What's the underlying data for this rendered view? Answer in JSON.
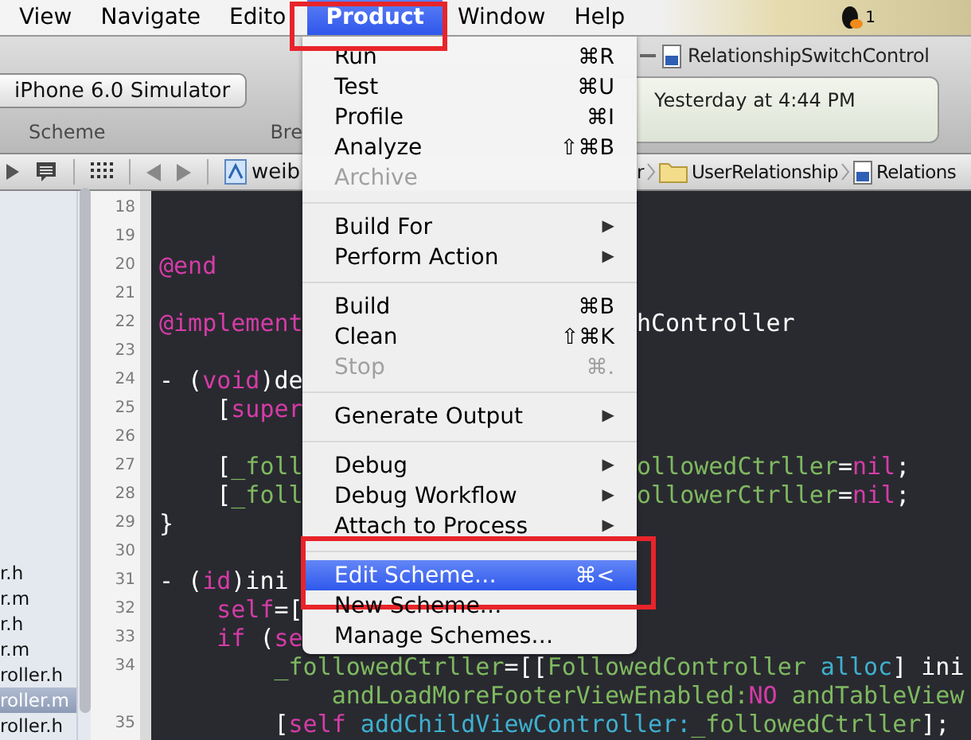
{
  "menubar": {
    "items": [
      {
        "label": "View",
        "selected": false,
        "outlined": false
      },
      {
        "label": "Navigate",
        "selected": false,
        "outlined": false
      },
      {
        "label": "Edito",
        "selected": false,
        "outlined": false
      },
      {
        "label": "Product",
        "selected": true,
        "outlined": true
      },
      {
        "label": "Window",
        "selected": false,
        "outlined": false
      },
      {
        "label": "Help",
        "selected": false,
        "outlined": false
      }
    ],
    "badge": "1"
  },
  "toolbar": {
    "scheme": "iPhone 6.0 Simulator",
    "labels": [
      "Scheme",
      "Bre"
    ],
    "document_title": "RelationshipSwitchControl",
    "activity": "Yesterday at 4:44 PM"
  },
  "jump_bar": {
    "left_text": "weib",
    "right_items": [
      {
        "kind": "text",
        "label": "r"
      },
      {
        "kind": "folder",
        "label": "UserRelationship"
      },
      {
        "kind": "source",
        "label": "Relations"
      }
    ]
  },
  "navigator": {
    "files": [
      {
        "name": "r.h",
        "selected": false
      },
      {
        "name": "r.m",
        "selected": false
      },
      {
        "name": "r.h",
        "selected": false
      },
      {
        "name": "r.m",
        "selected": false
      },
      {
        "name": "roller.h",
        "selected": false
      },
      {
        "name": "roller.m",
        "selected": true
      },
      {
        "name": "roller.h",
        "selected": false
      }
    ]
  },
  "menu": {
    "items": [
      {
        "kind": "item",
        "label": "Run",
        "shortcut": "⌘R",
        "disabled": false,
        "selected": false,
        "outlined": false
      },
      {
        "kind": "item",
        "label": "Test",
        "shortcut": "⌘U",
        "disabled": false,
        "selected": false,
        "outlined": false
      },
      {
        "kind": "item",
        "label": "Profile",
        "shortcut": "⌘I",
        "disabled": false,
        "selected": false,
        "outlined": false
      },
      {
        "kind": "item",
        "label": "Analyze",
        "shortcut": "⇧⌘B",
        "disabled": false,
        "selected": false,
        "outlined": false
      },
      {
        "kind": "item",
        "label": "Archive",
        "disabled": true,
        "selected": false,
        "outlined": false
      },
      {
        "kind": "separator"
      },
      {
        "kind": "submenu",
        "label": "Build For",
        "arrow": "▶",
        "disabled": false,
        "selected": false,
        "outlined": false
      },
      {
        "kind": "submenu",
        "label": "Perform Action",
        "arrow": "▶",
        "disabled": false,
        "selected": false,
        "outlined": false
      },
      {
        "kind": "separator"
      },
      {
        "kind": "item",
        "label": "Build",
        "shortcut": "⌘B",
        "disabled": false,
        "selected": false,
        "outlined": false
      },
      {
        "kind": "item",
        "label": "Clean",
        "shortcut": "⇧⌘K",
        "disabled": false,
        "selected": false,
        "outlined": false
      },
      {
        "kind": "item",
        "label": "Stop",
        "shortcut": "⌘.",
        "disabled": true,
        "selected": false,
        "outlined": false
      },
      {
        "kind": "separator"
      },
      {
        "kind": "submenu",
        "label": "Generate Output",
        "arrow": "▶",
        "disabled": false,
        "selected": false,
        "outlined": false
      },
      {
        "kind": "separator"
      },
      {
        "kind": "submenu",
        "label": "Debug",
        "arrow": "▶",
        "disabled": false,
        "selected": false,
        "outlined": false
      },
      {
        "kind": "submenu",
        "label": "Debug Workflow",
        "arrow": "▶",
        "disabled": false,
        "selected": false,
        "outlined": false
      },
      {
        "kind": "submenu",
        "label": "Attach to Process",
        "arrow": "▶",
        "disabled": false,
        "selected": false,
        "outlined": false
      },
      {
        "kind": "separator"
      },
      {
        "kind": "item",
        "label": "Edit Scheme…",
        "shortcut": "⌘<",
        "disabled": false,
        "selected": true,
        "outlined": true
      },
      {
        "kind": "item",
        "label": "New Scheme…",
        "disabled": false,
        "selected": false,
        "outlined": false
      },
      {
        "kind": "item",
        "label": "Manage Schemes…",
        "disabled": false,
        "selected": false,
        "outlined": false
      }
    ]
  },
  "editor": {
    "lines": [
      {
        "number": "18"
      },
      {
        "number": "19"
      },
      {
        "number": "20",
        "left": [
          {
            "text": "@end",
            "kind": "keyword"
          }
        ]
      },
      {
        "number": "21"
      },
      {
        "number": "22",
        "left": [
          {
            "text": "@implement",
            "kind": "keyword"
          }
        ],
        "right": [
          {
            "text": "hController",
            "kind": "plain"
          }
        ]
      },
      {
        "number": "23"
      },
      {
        "number": "24",
        "left": [
          {
            "text": "- (",
            "kind": "plain"
          },
          {
            "text": "void",
            "kind": "keyword"
          },
          {
            "text": ")de",
            "kind": "plain"
          }
        ]
      },
      {
        "number": "25",
        "left": [
          {
            "text": "    [",
            "kind": "plain"
          },
          {
            "text": "super",
            "kind": "keyword"
          }
        ]
      },
      {
        "number": "26"
      },
      {
        "number": "27",
        "left": [
          {
            "text": "    [",
            "kind": "plain"
          },
          {
            "text": "_foll",
            "kind": "project"
          }
        ],
        "right": [
          {
            "text": "ollowedCtrller",
            "kind": "project"
          },
          {
            "text": "=",
            "kind": "plain"
          },
          {
            "text": "nil",
            "kind": "keyword"
          },
          {
            "text": ";",
            "kind": "plain"
          }
        ]
      },
      {
        "number": "28",
        "left": [
          {
            "text": "    [",
            "kind": "plain"
          },
          {
            "text": "_foll",
            "kind": "project"
          }
        ],
        "right": [
          {
            "text": "ollowerCtrller",
            "kind": "project"
          },
          {
            "text": "=",
            "kind": "plain"
          },
          {
            "text": "nil",
            "kind": "keyword"
          },
          {
            "text": ";",
            "kind": "plain"
          }
        ]
      },
      {
        "number": "29",
        "left": [
          {
            "text": "}",
            "kind": "plain"
          }
        ]
      },
      {
        "number": "30"
      },
      {
        "number": "31",
        "left": [
          {
            "text": "- (",
            "kind": "plain"
          },
          {
            "text": "id",
            "kind": "keyword"
          },
          {
            "text": ")ini",
            "kind": "plain"
          }
        ]
      },
      {
        "number": "32",
        "left": [
          {
            "text": "    self",
            "kind": "keyword"
          },
          {
            "text": "=[",
            "kind": "plain"
          }
        ]
      },
      {
        "number": "33",
        "left": [
          {
            "text": "    if",
            "kind": "keyword"
          },
          {
            "text": " (",
            "kind": "plain"
          },
          {
            "text": "se",
            "kind": "keyword"
          }
        ]
      },
      {
        "number": "34",
        "full": [
          {
            "text": "        _followedCtrller",
            "kind": "project"
          },
          {
            "text": "=[[",
            "kind": "plain"
          },
          {
            "text": "FollowedController",
            "kind": "project"
          },
          {
            "text": " alloc",
            "kind": "system"
          },
          {
            "text": "] ini",
            "kind": "plain"
          }
        ]
      },
      {
        "full": [
          {
            "text": "            andLoadMoreFooterViewEnabled:",
            "kind": "project"
          },
          {
            "text": "NO",
            "kind": "keyword"
          },
          {
            "text": " andTableView",
            "kind": "project"
          }
        ]
      },
      {
        "number": "35",
        "full": [
          {
            "text": "        [",
            "kind": "plain"
          },
          {
            "text": "self",
            "kind": "keyword"
          },
          {
            "text": " addChildViewController:",
            "kind": "system"
          },
          {
            "text": "_followedCtrller",
            "kind": "project"
          },
          {
            "text": "];",
            "kind": "plain"
          }
        ]
      }
    ]
  }
}
